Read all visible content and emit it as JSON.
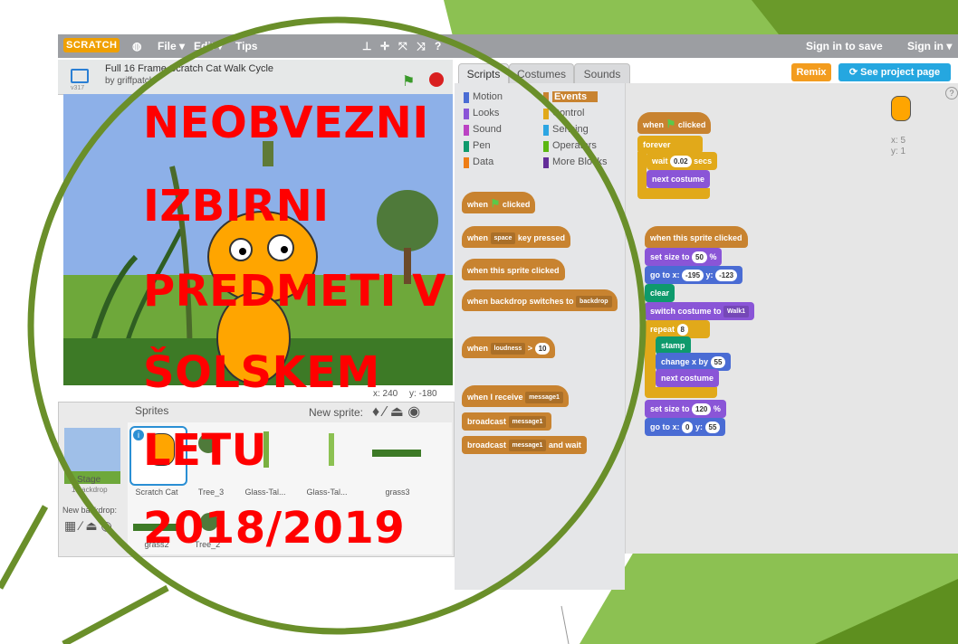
{
  "menu": {
    "logo": "SCRATCH",
    "file": "File ▾",
    "edit": "Edit ▾",
    "tips": "Tips",
    "sign_in_to_save": "Sign in to save",
    "sign_in": "Sign in ▾"
  },
  "project": {
    "title": "Full 16 Frame Scratch Cat Walk Cycle",
    "author": "by griffpatch",
    "version": "v317"
  },
  "tabs": {
    "scripts": "Scripts",
    "costumes": "Costumes",
    "sounds": "Sounds"
  },
  "buttons": {
    "remix": "Remix",
    "see_project_page": "See project page"
  },
  "categories": [
    {
      "label": "Motion",
      "color": "#4a6cd4"
    },
    {
      "label": "Events",
      "color": "#c88330"
    },
    {
      "label": "Looks",
      "color": "#8a55d7"
    },
    {
      "label": "Control",
      "color": "#e1a91a"
    },
    {
      "label": "Sound",
      "color": "#bb42c3"
    },
    {
      "label": "Sensing",
      "color": "#2ca5e2"
    },
    {
      "label": "Pen",
      "color": "#0e9a6c"
    },
    {
      "label": "Operators",
      "color": "#5cb712"
    },
    {
      "label": "Data",
      "color": "#ee7d16"
    },
    {
      "label": "More Blocks",
      "color": "#632d99"
    }
  ],
  "palette": {
    "when_clicked": "when",
    "clicked": "clicked",
    "when_key": "when",
    "key_space": "space",
    "key_pressed": "key pressed",
    "when_sprite_clicked": "when this sprite clicked",
    "when_backdrop": "when backdrop switches to",
    "backdrop_dd": "backdrop",
    "when_loudness": "when",
    "loudness_dd": "loudness",
    "gt": ">",
    "loudness_val": "10",
    "when_receive": "when I receive",
    "message1": "message1",
    "broadcast": "broadcast",
    "broadcast_wait": "broadcast",
    "and_wait": "and wait"
  },
  "script1": {
    "when": "when",
    "clicked": "clicked",
    "forever": "forever",
    "wait": "wait",
    "wait_val": "0.02",
    "secs": "secs",
    "next_costume": "next costume"
  },
  "script2": {
    "hat": "when this sprite clicked",
    "set_size": "set size to",
    "size_val": "50",
    "pct": "%",
    "goto": "go to x:",
    "x_val": "-195",
    "y_label": "y:",
    "y_val": "-123",
    "clear": "clear",
    "switch_costume": "switch costume to",
    "costume_dd": "Walk1",
    "repeat": "repeat",
    "repeat_val": "8",
    "stamp": "stamp",
    "change_x": "change x by",
    "change_val": "55",
    "next_costume": "next costume",
    "set_size2": "set size to",
    "size_val2": "120",
    "pct2": "%",
    "goto2": "go to x:",
    "x_val2": "0",
    "y_label2": "y:",
    "y_val2": "55"
  },
  "sprite_info": {
    "x": "x: 5",
    "y": "y: 1"
  },
  "stage_coords": {
    "x": "x: 240",
    "y": "y: -180"
  },
  "sprites_panel": {
    "title": "Sprites",
    "new_sprite": "New sprite:",
    "stage_label": "Stage",
    "stage_sub": "1 backdrop",
    "new_backdrop": "New backdrop:",
    "items": [
      "Scratch Cat",
      "Tree_3",
      "Glass-Tal...",
      "Glass-Tal...",
      "grass3",
      "grass2",
      "Tree_2"
    ]
  },
  "overlay": {
    "line1": "NEOBVEZNI",
    "line2": "IZBIRNI",
    "line3": "PREDMETI V",
    "line4": "ŠOLSKEM",
    "line5": "LETU",
    "line6": "2018/2019"
  },
  "colors": {
    "accent_green": "#6a8f2a",
    "overlay_red": "#ff0000",
    "remix": "#f39c1e",
    "see_project": "#25a7e0"
  }
}
